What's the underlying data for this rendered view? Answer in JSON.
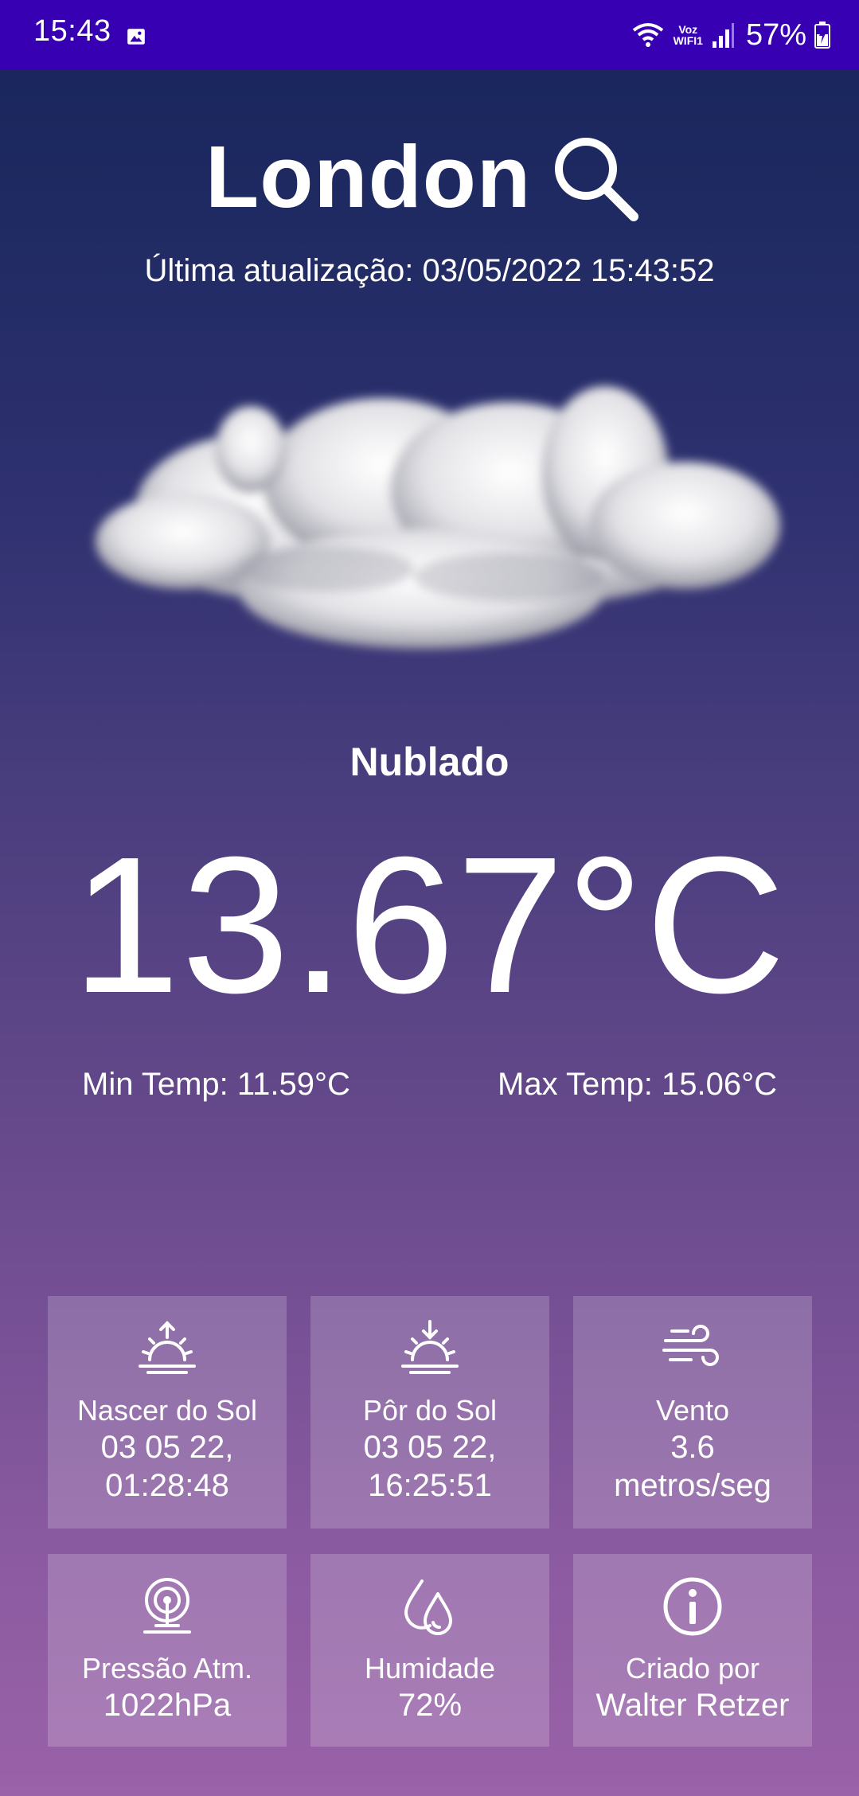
{
  "status_bar": {
    "time": "15:43",
    "voz": "Voz",
    "wifi_label": "WIFI1",
    "battery": "57%",
    "icons": [
      "image-icon",
      "wifi-icon",
      "signal-icon",
      "battery-icon"
    ]
  },
  "header": {
    "city": "London",
    "last_update": "Última atualização: 03/05/2022 15:43:52"
  },
  "weather": {
    "condition": "Nublado",
    "temperature": "13.67°C",
    "min_temp": "Min Temp: 11.59°C",
    "max_temp": "Max Temp: 15.06°C",
    "image": "cloud-image"
  },
  "tiles": [
    {
      "icon": "sunrise-icon",
      "label": "Nascer do Sol",
      "value_line1": "03 05 22,",
      "value_line2": "01:28:48"
    },
    {
      "icon": "sunset-icon",
      "label": "Pôr do Sol",
      "value_line1": "03 05 22,",
      "value_line2": "16:25:51"
    },
    {
      "icon": "wind-icon",
      "label": "Vento",
      "value_line1": "3.6",
      "value_line2": "metros/seg"
    },
    {
      "icon": "pressure-icon",
      "label": "Pressão Atm.",
      "value_line1": "1022hPa"
    },
    {
      "icon": "humidity-icon",
      "label": "Humidade",
      "value_line1": "72%"
    },
    {
      "icon": "info-icon",
      "label": "Criado por",
      "value_line1": "Walter Retzer"
    }
  ],
  "colors": {
    "status_bar": "#3700b3",
    "gradient_top": "#17245a",
    "gradient_bottom": "#9a62a8",
    "tile_bg": "rgba(255,255,255,0.18)",
    "text": "#ffffff"
  }
}
